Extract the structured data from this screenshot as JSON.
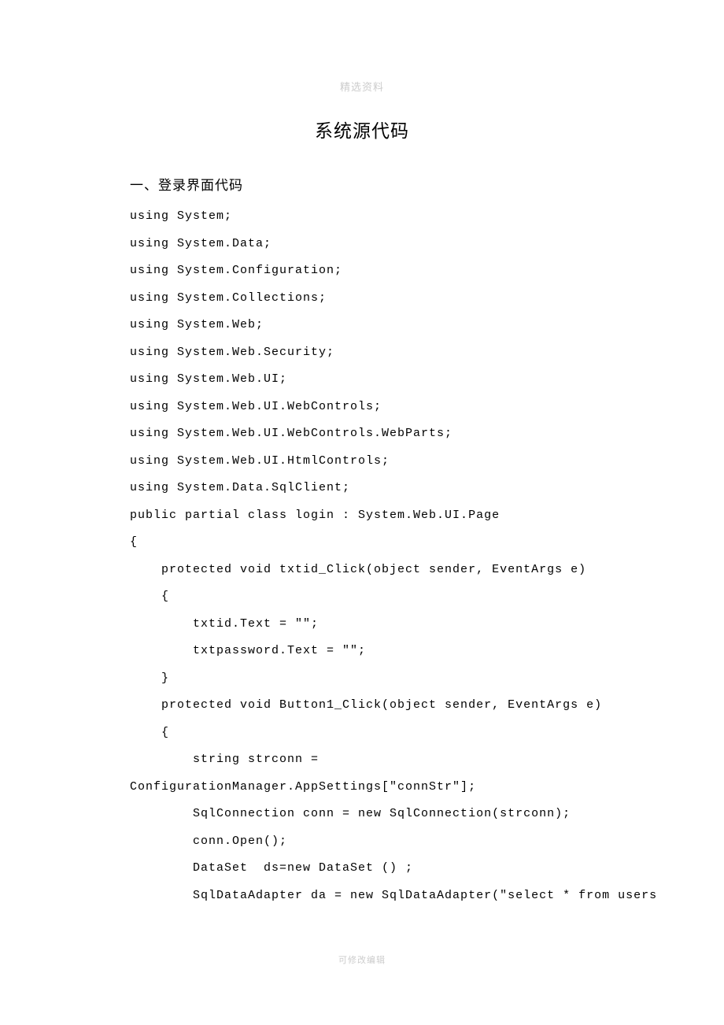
{
  "header_watermark": "精选资料",
  "title": "系统源代码",
  "section_heading": "一、登录界面代码",
  "code_lines": [
    "using System;",
    "using System.Data;",
    "using System.Configuration;",
    "using System.Collections;",
    "using System.Web;",
    "using System.Web.Security;",
    "using System.Web.UI;",
    "using System.Web.UI.WebControls;",
    "using System.Web.UI.WebControls.WebParts;",
    "using System.Web.UI.HtmlControls;",
    "using System.Data.SqlClient;",
    "",
    "public partial class login : System.Web.UI.Page",
    "{",
    "    protected void txtid_Click(object sender, EventArgs e)",
    "    {",
    "        txtid.Text = \"\";",
    "        txtpassword.Text = \"\";",
    "    }",
    "    protected void Button1_Click(object sender, EventArgs e)",
    "    {",
    "        string strconn = ",
    "ConfigurationManager.AppSettings[\"connStr\"];",
    "        SqlConnection conn = new SqlConnection(strconn);",
    "        conn.Open();",
    "        DataSet  ds=new DataSet () ;",
    "        SqlDataAdapter da = new SqlDataAdapter(\"select * from users "
  ],
  "footer_watermark": "可修改编辑"
}
